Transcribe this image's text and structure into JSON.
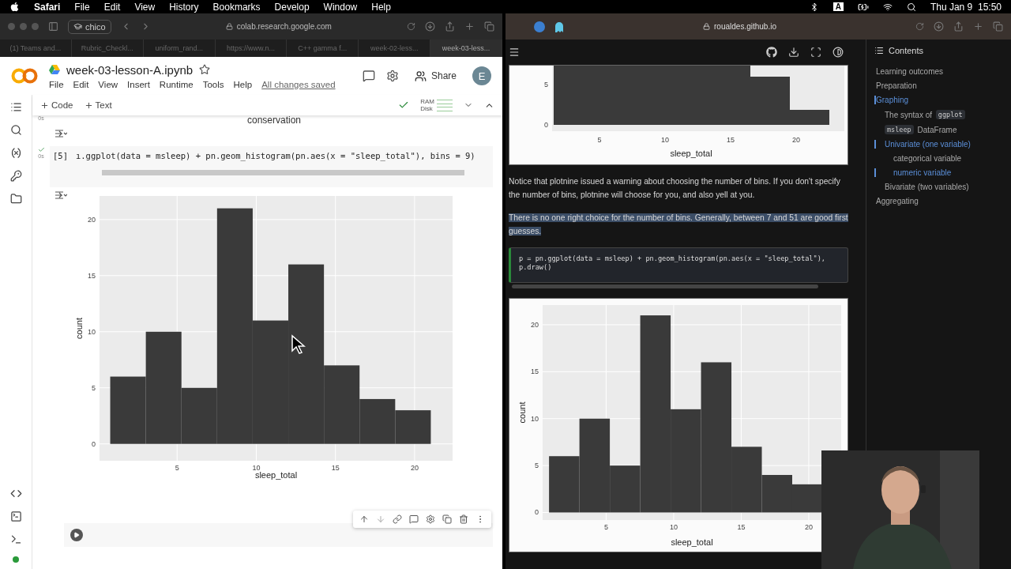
{
  "menu_bar": {
    "app": "Safari",
    "menus": [
      "File",
      "Edit",
      "View",
      "History",
      "Bookmarks",
      "Develop",
      "Window",
      "Help"
    ],
    "input_source": "A",
    "clock": "Thu Jan 9  15:50"
  },
  "left_window": {
    "profile": "chico",
    "address": "colab.research.google.com",
    "tabs": [
      {
        "label": "(1) Teams and...",
        "selected": false
      },
      {
        "label": "Rubric_Checkl...",
        "selected": false
      },
      {
        "label": "uniform_rand...",
        "selected": false
      },
      {
        "label": "https://www.n...",
        "selected": false
      },
      {
        "label": "C++ gamma f...",
        "selected": false
      },
      {
        "label": "week-02-less...",
        "selected": false
      },
      {
        "label": "week-03-less...",
        "selected": true
      }
    ]
  },
  "colab": {
    "title": "week-03-lesson-A.ipynb",
    "menus": [
      "File",
      "Edit",
      "View",
      "Insert",
      "Runtime",
      "Tools",
      "Help"
    ],
    "save_status": "All changes saved",
    "share": "Share",
    "avatar": "E",
    "toolbar": {
      "add_code": "Code",
      "add_text": "Text",
      "ram": "RAM",
      "disk": "Disk"
    },
    "prev_cell": {
      "time": "0s",
      "output_text": "conservation"
    },
    "cell": {
      "count": "[5]",
      "time": "0s",
      "code": "ı.ggplot(data = msleep) + pn.geom_histogram(pn.aes(x = \"sleep_total\"), bins = 9)",
      "chart_data": {
        "type": "bar",
        "grid": true,
        "xlabel": "sleep_total",
        "ylabel": "count",
        "x": [
          1.9,
          4.15,
          6.4,
          8.65,
          10.9,
          13.15,
          15.4,
          17.65,
          19.9
        ],
        "values": [
          6,
          10,
          5,
          21,
          11,
          16,
          7,
          4,
          3
        ],
        "xlim": [
          0.1,
          22.4
        ],
        "ylim": [
          -1.5,
          22.1
        ],
        "xticks": [
          5,
          10,
          15,
          20
        ],
        "yticks": [
          0,
          5,
          10,
          15,
          20
        ]
      }
    }
  },
  "right_window": {
    "address": "roualdes.github.io",
    "previous_plot": {
      "yticks": [
        "5",
        "0"
      ],
      "xticks": [
        "5",
        "10",
        "15",
        "20"
      ],
      "xlabel": "sleep_total"
    },
    "paragraphs": [
      {
        "text": "Notice that plotnine issued a warning about choosing the number of bins. If you don't specify the number of bins, plotnine will choose for you, and also yell at you.",
        "highlighted": false
      },
      {
        "text": "There is no one right choice for the number of bins. Generally, between 7 and 51 are good first guesses.",
        "highlighted": true
      }
    ],
    "code_lines": [
      "p = pn.ggplot(data = msleep) + pn.geom_histogram(pn.aes(x = \"sleep_total\"),",
      "p.draw()"
    ],
    "chart_data": {
      "type": "bar",
      "grid": true,
      "xlabel": "sleep_total",
      "ylabel": "count",
      "x": [
        1.9,
        4.15,
        6.4,
        8.65,
        10.9,
        13.15,
        15.4,
        17.65,
        19.9
      ],
      "values": [
        6,
        10,
        5,
        21,
        11,
        16,
        7,
        4,
        3
      ],
      "xlim": [
        0.3,
        22.4
      ],
      "ylim": [
        -0.8,
        22.1
      ],
      "xticks": [
        5,
        10,
        15,
        20
      ],
      "yticks": [
        0,
        5,
        10,
        15,
        20
      ]
    },
    "contents": {
      "title": "Contents",
      "items": [
        {
          "parts": [
            {
              "kind": "text",
              "text": "Learning outcomes"
            }
          ],
          "selected": false
        },
        {
          "parts": [
            {
              "kind": "text",
              "text": "Preparation"
            }
          ],
          "selected": false
        },
        {
          "parts": [
            {
              "kind": "text",
              "text": "Graphing"
            }
          ],
          "selected": true,
          "children": [
            {
              "parts": [
                {
                  "kind": "text",
                  "text": "The syntax of "
                },
                {
                  "kind": "code",
                  "text": "ggplot"
                }
              ],
              "selected": false
            },
            {
              "parts": [
                {
                  "kind": "code",
                  "text": "msleep"
                },
                {
                  "kind": "text",
                  "text": " DataFrame"
                }
              ],
              "selected": false
            },
            {
              "parts": [
                {
                  "kind": "text",
                  "text": "Univariate (one variable)"
                }
              ],
              "selected": true,
              "children": [
                {
                  "parts": [
                    {
                      "kind": "text",
                      "text": "categorical variable"
                    }
                  ],
                  "selected": false
                },
                {
                  "parts": [
                    {
                      "kind": "text",
                      "text": "numeric variable"
                    }
                  ],
                  "selected": true
                }
              ]
            },
            {
              "parts": [
                {
                  "kind": "text",
                  "text": "Bivariate (two variables)"
                }
              ],
              "selected": false
            }
          ]
        },
        {
          "parts": [
            {
              "kind": "text",
              "text": "Aggregating"
            }
          ],
          "selected": false
        }
      ]
    }
  }
}
